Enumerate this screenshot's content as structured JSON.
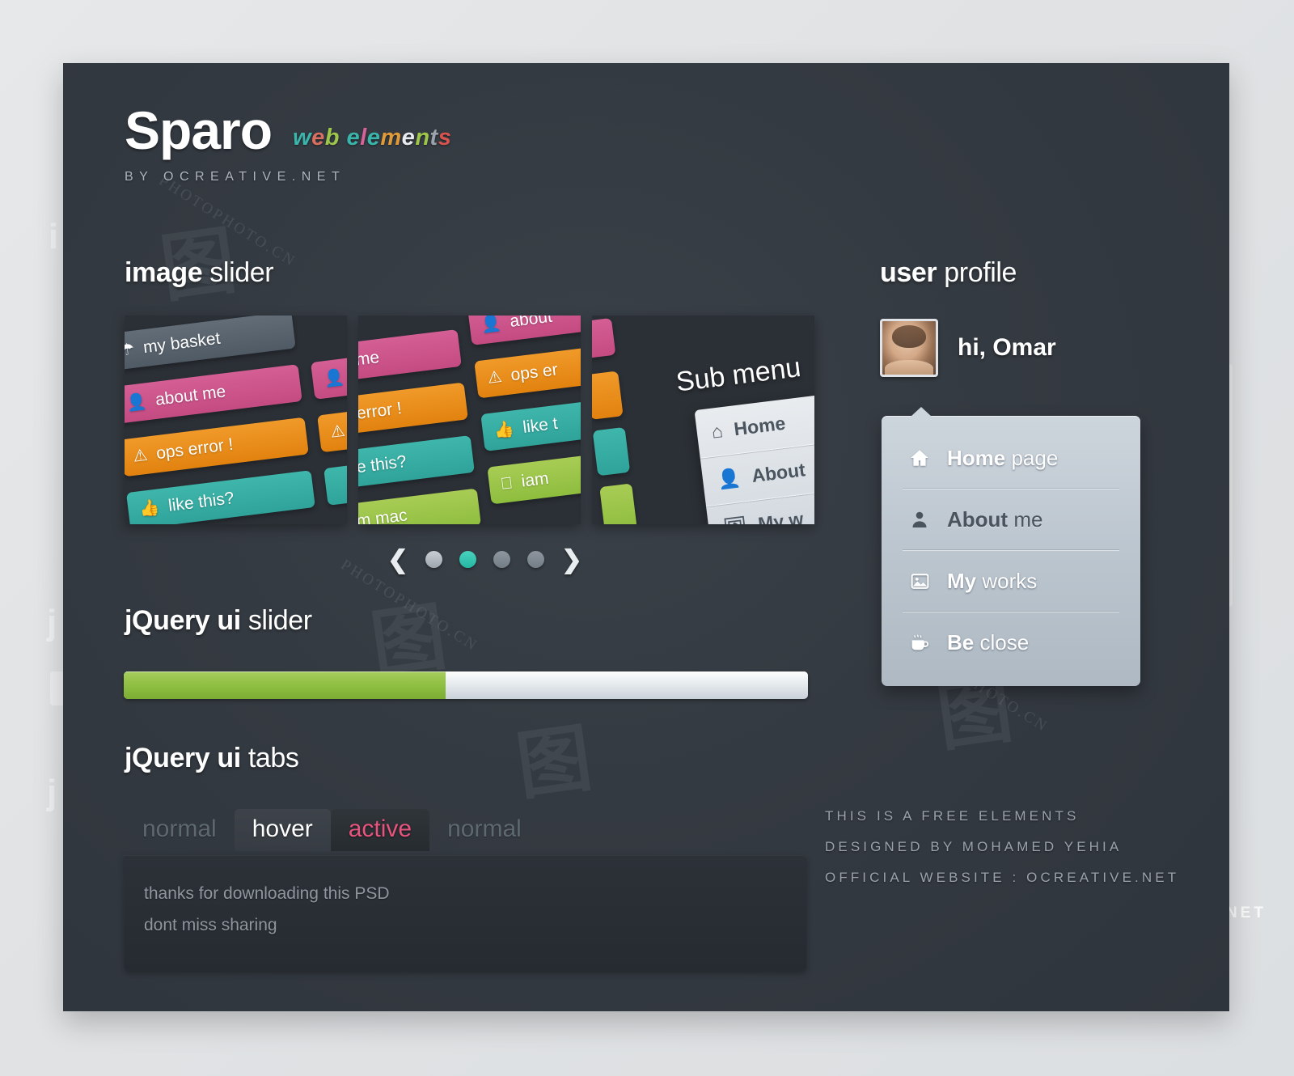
{
  "brand": {
    "name": "Sparo",
    "tagline_letters": [
      {
        "ch": "w",
        "color": "#3ab5ab"
      },
      {
        "ch": "e",
        "color": "#d96f60"
      },
      {
        "ch": "b",
        "color": "#9ec64a"
      },
      {
        "ch": " ",
        "color": "#ffffff"
      },
      {
        "ch": "e",
        "color": "#3ab5ab"
      },
      {
        "ch": "l",
        "color": "#d4639a"
      },
      {
        "ch": "e",
        "color": "#3ab5ab"
      },
      {
        "ch": "m",
        "color": "#e09a3a"
      },
      {
        "ch": "e",
        "color": "#e8ecef"
      },
      {
        "ch": "n",
        "color": "#9ec64a"
      },
      {
        "ch": "t",
        "color": "#9aa3ab"
      },
      {
        "ch": "s",
        "color": "#d9534f"
      }
    ],
    "tagline_plain": "web elements",
    "byline": "BY  OCREATIVE.NET"
  },
  "sections": {
    "image_slider": {
      "bold": "image",
      "light": " slider"
    },
    "jquery_slider": {
      "bold": "jQuery ui",
      "light": " slider"
    },
    "jquery_tabs": {
      "bold": "jQuery ui",
      "light": " tabs"
    },
    "user_profile": {
      "bold": "user",
      "light": " profile"
    }
  },
  "slider": {
    "slide1_buttons": [
      {
        "label": "my basket",
        "icon": "basket-icon",
        "glyph": "⛁",
        "color": "gray"
      },
      {
        "label": "about me",
        "icon": "user-icon",
        "glyph": "👤",
        "color": "pink"
      },
      {
        "label": "ops error !",
        "icon": "warning-icon",
        "glyph": "⚠",
        "color": "orange"
      },
      {
        "label": "like this?",
        "icon": "thumbs-up-icon",
        "glyph": "👍",
        "color": "teal"
      }
    ],
    "slide1_side_buttons": [
      {
        "label": "",
        "icon": "user-icon",
        "glyph": "👤",
        "color": "pink"
      },
      {
        "label": "",
        "icon": "warning-icon",
        "glyph": "⚠",
        "color": "orange"
      },
      {
        "label": "",
        "icon": "thumbs-up-icon",
        "glyph": "",
        "color": "teal"
      }
    ],
    "slide2_left": [
      {
        "label": "out me",
        "icon": "",
        "glyph": "",
        "color": "pink"
      },
      {
        "label": "ps error !",
        "icon": "",
        "glyph": "",
        "color": "orange"
      },
      {
        "label": "like this?",
        "icon": "",
        "glyph": "",
        "color": "teal"
      },
      {
        "label": "am mac",
        "icon": "",
        "glyph": "",
        "color": "green"
      }
    ],
    "slide2_right": [
      {
        "label": "about",
        "icon": "user-icon",
        "glyph": "👤",
        "color": "pink"
      },
      {
        "label": "ops er",
        "icon": "warning-icon",
        "glyph": "⚠",
        "color": "orange"
      },
      {
        "label": "like t",
        "icon": "thumbs-up-icon",
        "glyph": "👍",
        "color": "teal"
      },
      {
        "label": "iam",
        "icon": "apple-icon",
        "glyph": "",
        "color": "green"
      }
    ],
    "slide3_edge_colors": [
      "pink",
      "orange",
      "teal",
      "green",
      "red"
    ],
    "slide3_label": "Sub menu",
    "slide3_menu": [
      {
        "label": "Home",
        "icon": "home-icon",
        "glyph": "⌂"
      },
      {
        "label": "About",
        "icon": "user-icon",
        "glyph": "👤"
      },
      {
        "label": "My w",
        "icon": "image-icon",
        "glyph": "🖼"
      }
    ],
    "nav": {
      "prev": "❮",
      "next": "❯",
      "dot_count": 4,
      "active_dot": 2
    }
  },
  "jquery_slider": {
    "value_percent": 47,
    "fill_color": "#8ebe3e",
    "track_color": "#e9edf0"
  },
  "tabs": {
    "items": [
      {
        "label": "normal",
        "state": "normal"
      },
      {
        "label": "hover",
        "state": "hover"
      },
      {
        "label": "active",
        "state": "active"
      },
      {
        "label": "normal",
        "state": "normal"
      }
    ],
    "active_color": "#e8547d",
    "panel_lines": [
      "thanks for downloading this PSD",
      "dont miss sharing"
    ]
  },
  "profile": {
    "greeting": "hi, Omar",
    "menu": [
      {
        "bold": "Home",
        "light": " page",
        "icon": "home-icon",
        "glyph": "⌂",
        "state": "light"
      },
      {
        "bold": "About",
        "light": " me",
        "icon": "user-icon",
        "glyph": "👤",
        "state": "dark"
      },
      {
        "bold": "My",
        "light": " works",
        "icon": "image-icon",
        "glyph": "🖼",
        "state": "light"
      },
      {
        "bold": "Be",
        "light": " close",
        "icon": "coffee-icon",
        "glyph": "☕",
        "state": "light"
      }
    ]
  },
  "credits": [
    "THIS IS A FREE ELEMENTS",
    "DESIGNED BY MOHAMED YEHIA",
    "OFFICIAL WEBSITE : OCREATIVE.NET"
  ],
  "watermarks": {
    "cn_mark": "图",
    "photo_text": "PHOTOPHOTO.CN",
    "edge_ghost": "E.NET"
  }
}
